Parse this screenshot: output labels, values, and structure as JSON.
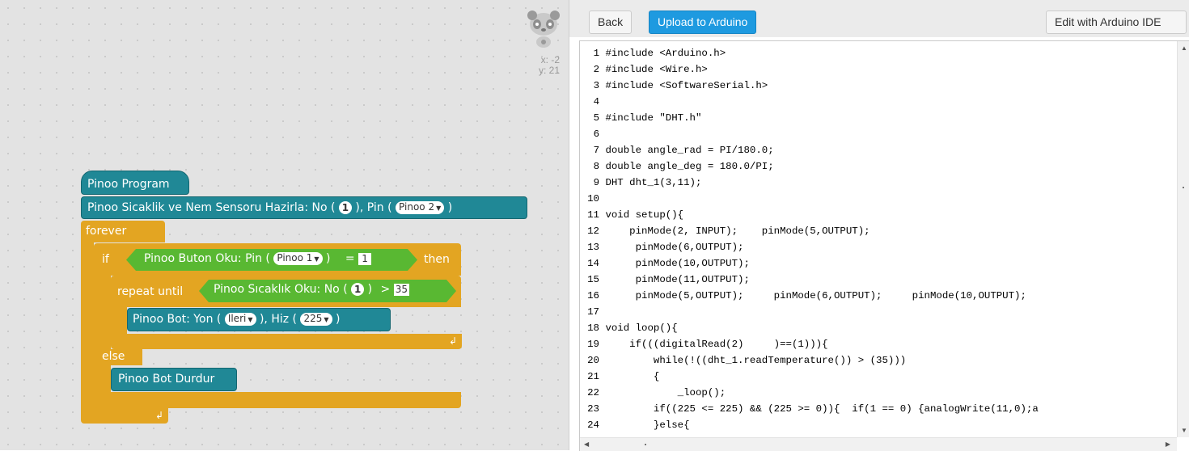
{
  "workspace": {
    "coords": {
      "x": "x: -2",
      "y": "y: 21"
    },
    "blocks": {
      "program": "Pinoo Program",
      "sensor_setup_prefix": "Pinoo Sicaklik ve Nem Sensoru Hazirla: No (",
      "sensor_setup_no": "1",
      "sensor_setup_mid": "), Pin (",
      "sensor_setup_pin": "Pinoo 2",
      "sensor_setup_suffix": ")",
      "forever": "forever",
      "if": "if",
      "button_read_prefix": "Pinoo Buton Oku: Pin (",
      "button_read_pin": "Pinoo 1",
      "button_read_suffix": ")",
      "equals": "=",
      "equals_value": "1",
      "then": "then",
      "repeat_until": "repeat until",
      "temp_read_prefix": "Pinoo Sıcaklık Oku: No (",
      "temp_read_no": "1",
      "temp_read_suffix": ")",
      "greater": ">",
      "greater_value": "35",
      "bot_prefix": "Pinoo Bot: Yon (",
      "bot_dir": "Ileri",
      "bot_mid": "), Hiz (",
      "bot_speed": "225",
      "bot_suffix": ")",
      "else": "else",
      "bot_stop": "Pinoo Bot Durdur"
    },
    "colors": {
      "teal": "#208896",
      "gold": "#e3a522",
      "green": "#59b832"
    }
  },
  "toolbar": {
    "back": "Back",
    "upload": "Upload to Arduino",
    "edit": "Edit with Arduino IDE"
  },
  "code": {
    "lines": [
      {
        "n": "1",
        "text": "#include <Arduino.h>"
      },
      {
        "n": "2",
        "text": "#include <Wire.h>"
      },
      {
        "n": "3",
        "text": "#include <SoftwareSerial.h>"
      },
      {
        "n": "4",
        "text": ""
      },
      {
        "n": "5",
        "text": "#include \"DHT.h\""
      },
      {
        "n": "6",
        "text": ""
      },
      {
        "n": "7",
        "text": "double angle_rad = PI/180.0;"
      },
      {
        "n": "8",
        "text": "double angle_deg = 180.0/PI;"
      },
      {
        "n": "9",
        "text": "DHT dht_1(3,11);"
      },
      {
        "n": "10",
        "text": ""
      },
      {
        "n": "11",
        "text": "void setup(){"
      },
      {
        "n": "12",
        "text": "    pinMode(2, INPUT);    pinMode(5,OUTPUT);"
      },
      {
        "n": "13",
        "text": "     pinMode(6,OUTPUT);"
      },
      {
        "n": "14",
        "text": "     pinMode(10,OUTPUT);"
      },
      {
        "n": "15",
        "text": "     pinMode(11,OUTPUT);"
      },
      {
        "n": "16",
        "text": "     pinMode(5,OUTPUT);     pinMode(6,OUTPUT);     pinMode(10,OUTPUT);"
      },
      {
        "n": "17",
        "text": ""
      },
      {
        "n": "18",
        "text": "void loop(){"
      },
      {
        "n": "19",
        "text": "    if(((digitalRead(2)     )==(1))){"
      },
      {
        "n": "20",
        "text": "        while(!((dht_1.readTemperature()) > (35)))"
      },
      {
        "n": "21",
        "text": "        {"
      },
      {
        "n": "22",
        "text": "            _loop();"
      },
      {
        "n": "23",
        "text": "        if((225 <= 225) && (225 >= 0)){  if(1 == 0) {analogWrite(11,0);a"
      },
      {
        "n": "24",
        "text": "        }else{"
      }
    ]
  }
}
